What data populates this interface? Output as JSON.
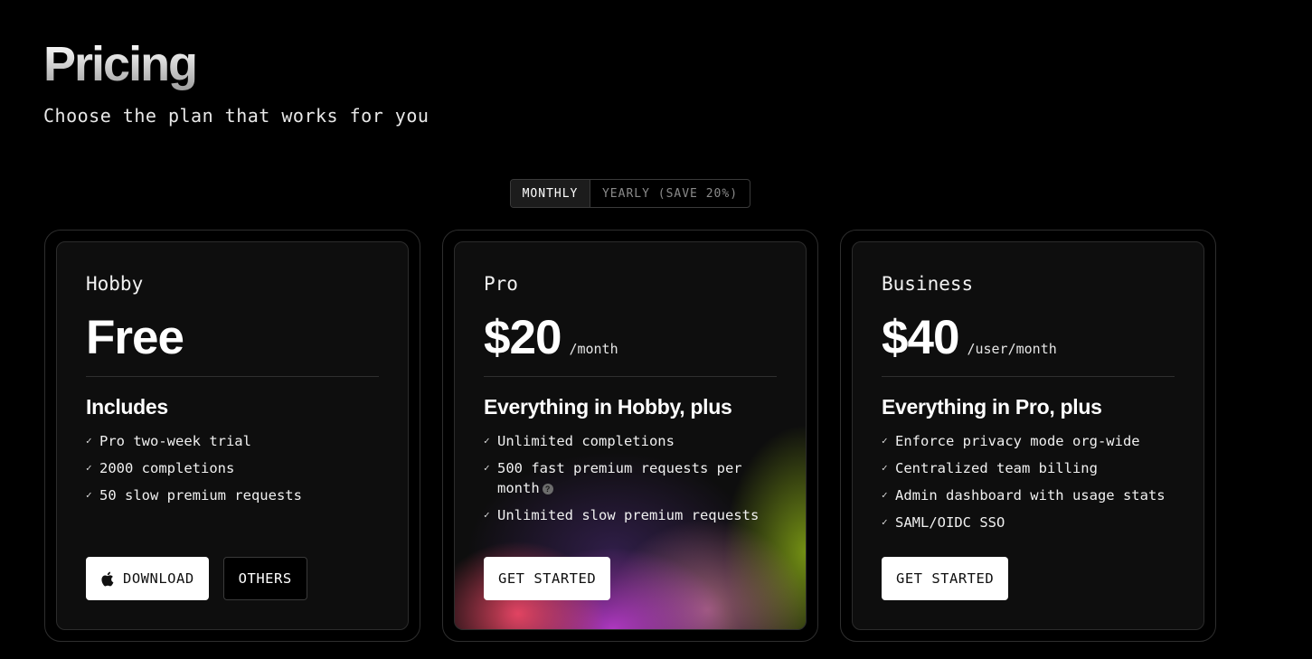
{
  "header": {
    "title": "Pricing",
    "subtitle": "Choose the plan that works for you"
  },
  "billing_toggle": {
    "monthly_label": "MONTHLY",
    "yearly_label": "YEARLY (SAVE 20%)",
    "selected": "MONTHLY"
  },
  "plans": [
    {
      "name": "Hobby",
      "price": "Free",
      "price_unit": "",
      "includes_heading": "Includes",
      "features": [
        "Pro two-week trial",
        "2000 completions",
        "50 slow premium requests"
      ],
      "primary_button": "DOWNLOAD",
      "primary_icon": "apple-icon",
      "secondary_button": "OTHERS"
    },
    {
      "name": "Pro",
      "price": "$20",
      "price_unit": "/month",
      "includes_heading": "Everything in Hobby, plus",
      "features": [
        "Unlimited completions",
        "500 fast premium requests per month",
        "Unlimited slow premium requests"
      ],
      "help_icon_glyph": "?",
      "primary_button": "GET STARTED"
    },
    {
      "name": "Business",
      "price": "$40",
      "price_unit": "/user/month",
      "includes_heading": "Everything in Pro, plus",
      "features": [
        "Enforce privacy mode org-wide",
        "Centralized team billing",
        "Admin dashboard with usage stats",
        "SAML/OIDC SSO"
      ],
      "primary_button": "GET STARTED"
    }
  ],
  "colors": {
    "background": "#000000",
    "card": "#0e0e0e",
    "border": "#2e2e2e",
    "button_primary": "#ffffff"
  }
}
